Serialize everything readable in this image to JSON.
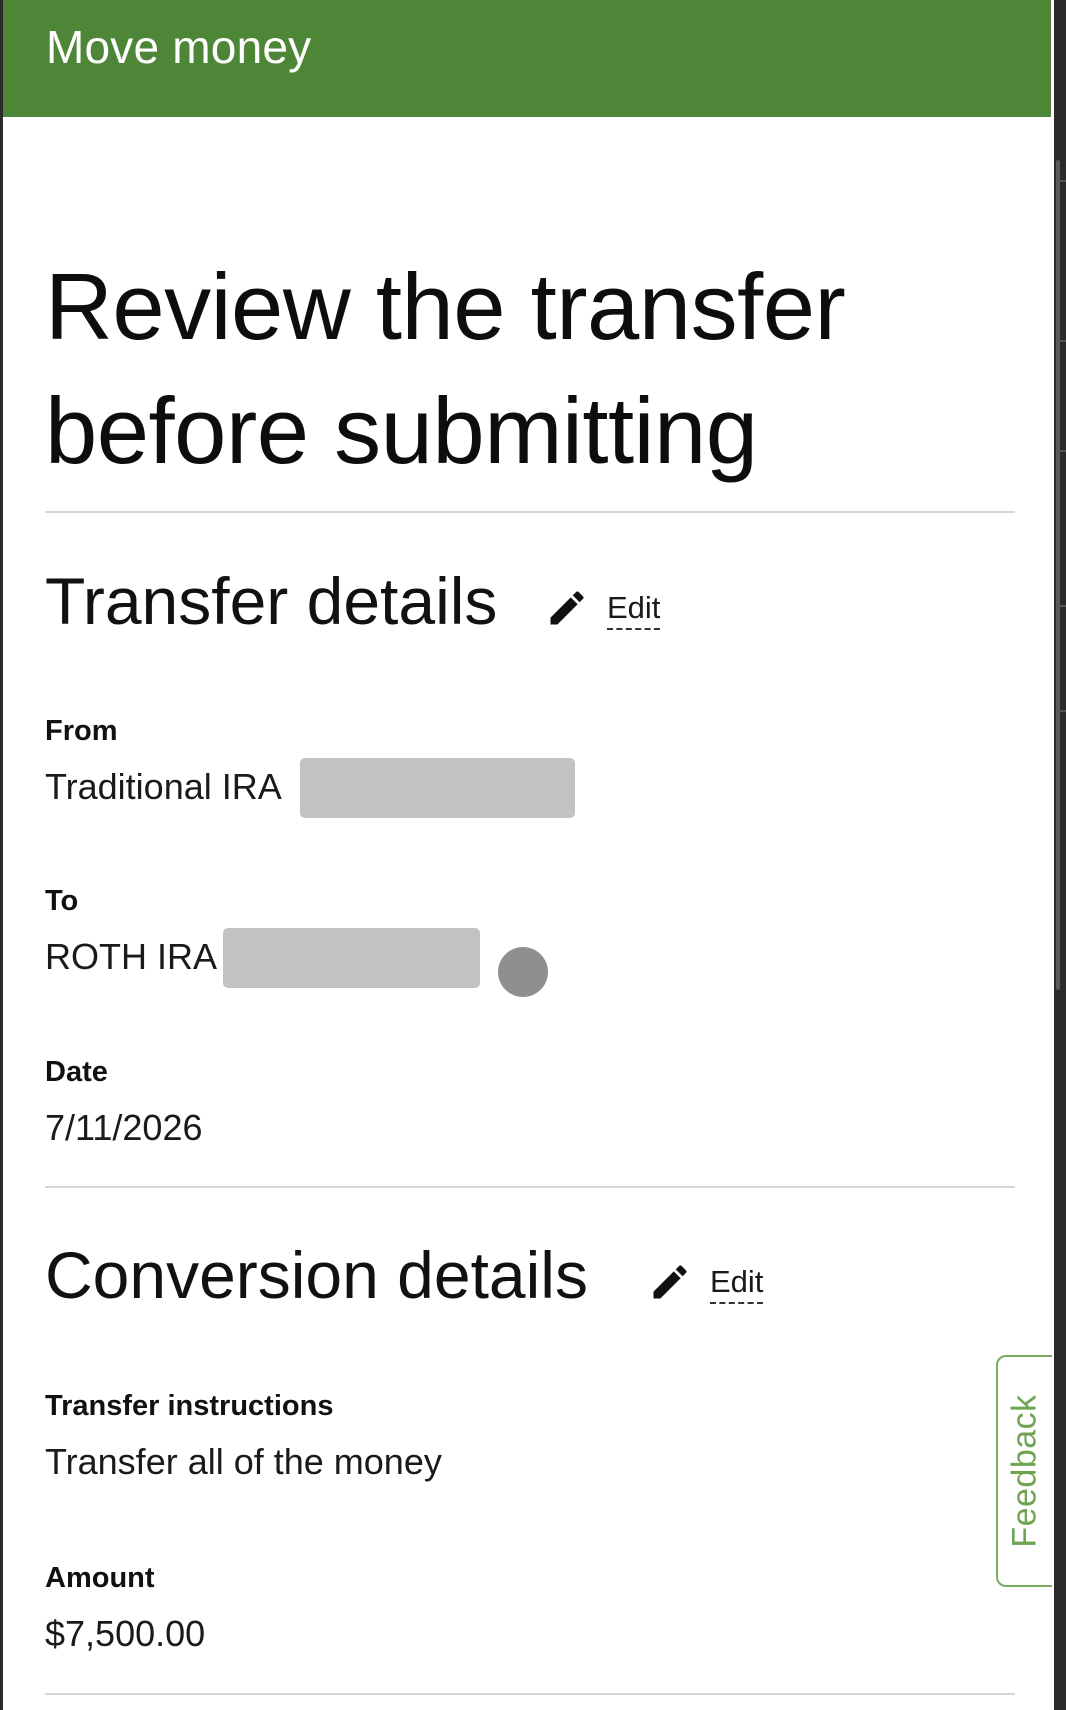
{
  "header": {
    "title": "Move money"
  },
  "page": {
    "title": "Review the transfer before submitting"
  },
  "transfer_details": {
    "title": "Transfer details",
    "edit_label": "Edit",
    "from_label": "From",
    "from_value": "Traditional IRA",
    "to_label": "To",
    "to_value": "ROTH IRA",
    "date_label": "Date",
    "date_value": "7/11/2026"
  },
  "conversion_details": {
    "title": "Conversion details",
    "edit_label": "Edit",
    "instructions_label": "Transfer instructions",
    "instructions_value": "Transfer all of the money",
    "amount_label": "Amount",
    "amount_value": "$7,500.00"
  },
  "feedback": {
    "label": "Feedback"
  },
  "colors": {
    "header_green": "#4e8638",
    "feedback_green": "#6ea451",
    "redaction_gray": "#c2c2c2"
  },
  "icons": {
    "edit": "pencil-icon",
    "info": "info-dot"
  }
}
